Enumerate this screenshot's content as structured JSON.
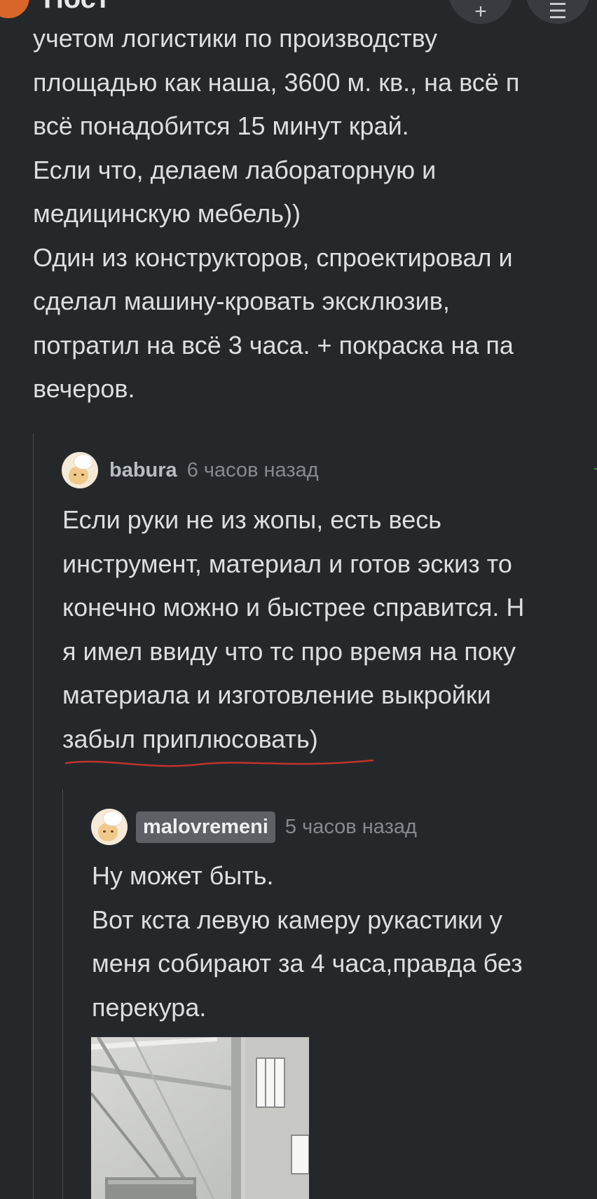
{
  "header": {
    "title": "Пост"
  },
  "post": {
    "lines": [
      "учетом логистики по производству",
      "площадью как наша, 3600 м. кв., на всё п",
      "всё понадобится 15 минут край.",
      "Если что, делаем лабораторную и",
      "медицинскую мебель))",
      "Один из конструкторов, спроектировал и",
      "сделал машину-кровать эксклюзив,",
      "потратил на всё 3 часа. + покраска на па",
      "вечеров."
    ]
  },
  "comments": [
    {
      "username": "babura",
      "time": "6 часов назад",
      "lines": [
        "Если руки не из жопы, есть весь",
        "инструмент, материал и готов эскиз то",
        "конечно можно и быстрее справится. Н",
        "я имел ввиду что тс про время на поку",
        "материала и изготовление выкройки",
        "забыл приплюсовать)"
      ]
    },
    {
      "username": "malovremeni",
      "time": "5 часов назад",
      "lines": [
        "Ну может быть.",
        "Вот кста левую камеру рукастики у",
        "меня собирают за 4 часа,правда без",
        "перекура."
      ]
    }
  ],
  "colors": {
    "background": "#25282b",
    "text": "#dcdee1",
    "muted": "#86898e",
    "underline_mark": "#c0322a",
    "accent_green": "#3b8a3e"
  }
}
